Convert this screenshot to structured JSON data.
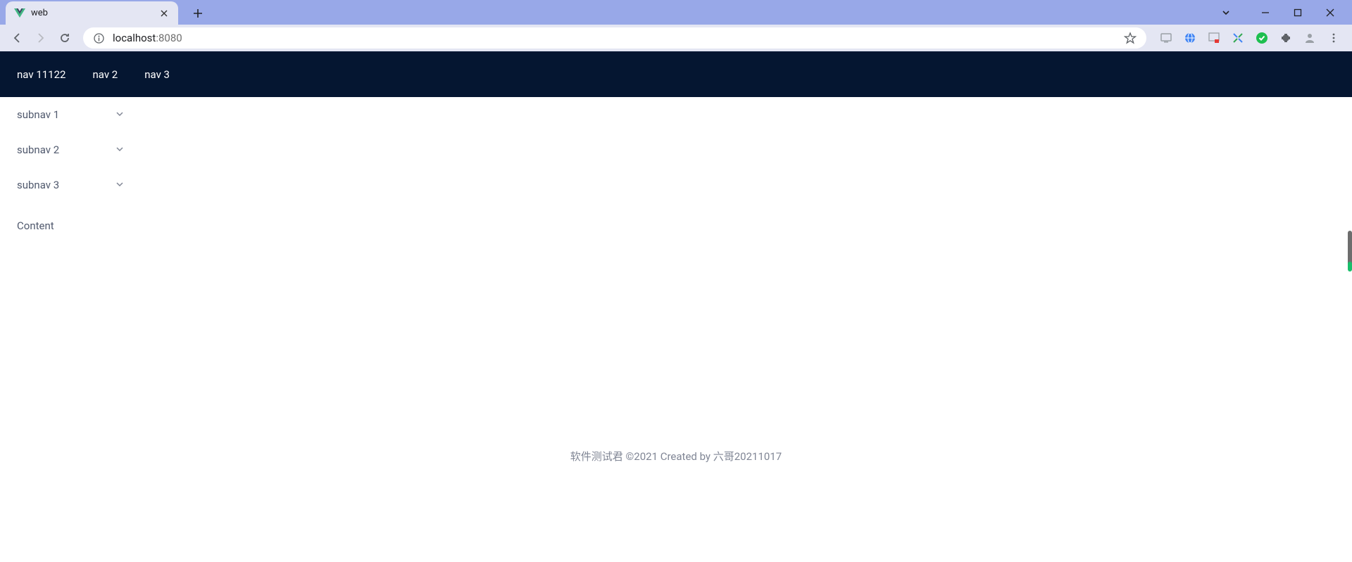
{
  "browser": {
    "tab": {
      "title": "web"
    },
    "address": {
      "host": "localhost",
      "port": ":8080"
    }
  },
  "topnav": {
    "items": [
      {
        "label": "nav 11122"
      },
      {
        "label": "nav 2"
      },
      {
        "label": "nav 3"
      }
    ]
  },
  "sidebar": {
    "items": [
      {
        "label": "subnav 1"
      },
      {
        "label": "subnav 2"
      },
      {
        "label": "subnav 3"
      }
    ]
  },
  "main": {
    "content": "Content"
  },
  "footer": {
    "text": "软件测试君 ©2021 Created by 六哥20211017"
  }
}
